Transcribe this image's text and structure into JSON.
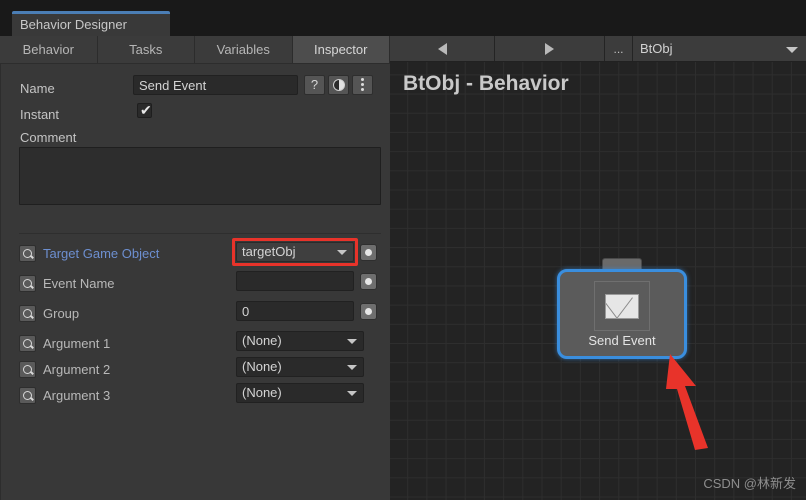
{
  "window": {
    "tab_title": "Behavior Designer",
    "accent_color": "#4b7eb5"
  },
  "tabs": [
    {
      "label": "Behavior",
      "active": false
    },
    {
      "label": "Tasks",
      "active": false
    },
    {
      "label": "Variables",
      "active": false
    },
    {
      "label": "Inspector",
      "active": true
    }
  ],
  "inspector": {
    "name_label": "Name",
    "name_value": "Send Event",
    "help_icon": "?",
    "instant_label": "Instant",
    "instant_checked": true,
    "instant_tick": "✔",
    "comment_label": "Comment",
    "comment_value": "",
    "properties": [
      {
        "label": "Target Game Object",
        "value": "targetObj",
        "control": "dropdown",
        "highlighted": true,
        "link": true
      },
      {
        "label": "Event Name",
        "value": "",
        "control": "textfield",
        "highlighted": false,
        "link": false
      },
      {
        "label": "Group",
        "value": "0",
        "control": "textfield",
        "highlighted": false,
        "link": false
      }
    ],
    "arguments": [
      {
        "label": "Argument 1",
        "value": "(None)"
      },
      {
        "label": "Argument 2",
        "value": "(None)"
      },
      {
        "label": "Argument 3",
        "value": "(None)"
      }
    ]
  },
  "graph": {
    "toolbar": {
      "back_label": "◀",
      "forward_label": "▶",
      "overflow_label": "...",
      "selected_object": "BtObj"
    },
    "title": "BtObj - Behavior",
    "node": {
      "label": "Send Event",
      "icon": "envelope-icon",
      "selected": true,
      "selection_color": "#3a8ede"
    },
    "annotation_color": "#e8332a"
  },
  "watermark": "CSDN @林新发"
}
